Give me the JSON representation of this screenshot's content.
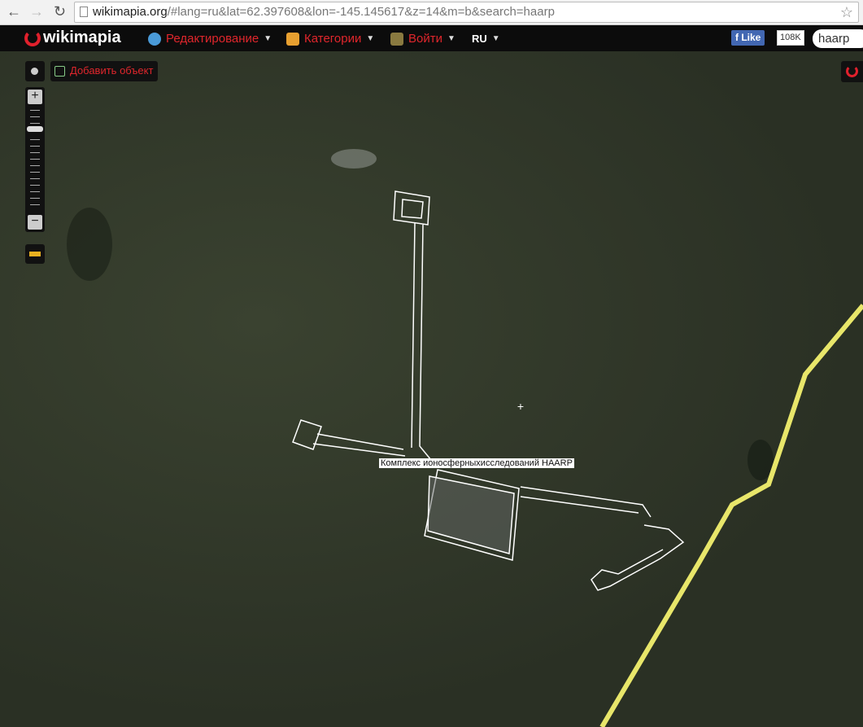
{
  "browser": {
    "url_host": "wikimapia.org",
    "url_rest": "/#lang=ru&lat=62.397608&lon=-145.145617&z=14&m=b&search=haarp"
  },
  "topbar": {
    "logo": "wikimapia",
    "menus": [
      {
        "label": "Редактирование"
      },
      {
        "label": "Категории"
      },
      {
        "label": "Войти"
      },
      {
        "label": "RU"
      }
    ],
    "fb_like": "Like",
    "fb_count": "108K",
    "search_value": "haarp"
  },
  "map": {
    "add_object": "Добавить объект",
    "object_label": "Комплекс ионосферныхисследований HAARP",
    "road_color": "#f0ee70",
    "outline_color": "#ffffff"
  }
}
